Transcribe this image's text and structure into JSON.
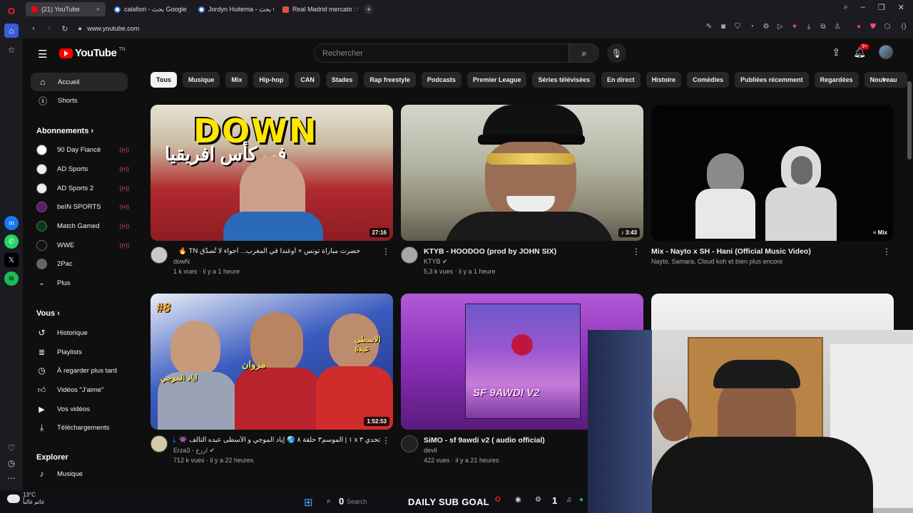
{
  "browser": {
    "tabs": [
      {
        "title": "(21) YouTube",
        "color": "#ff0000",
        "active": true
      },
      {
        "title": "calafiori - بحث Google",
        "color": "#4285f4"
      },
      {
        "title": "Jordyn Huitema - بحث Go",
        "color": "#4285f4"
      },
      {
        "title": "Real Madrid mercato : Un",
        "color": "#e0533d"
      }
    ],
    "url": "www.youtube.com"
  },
  "header": {
    "logo_text": "YouTube",
    "logo_region": "TN",
    "search_placeholder": "Rechercher",
    "notif_count": "9+"
  },
  "sidebar": {
    "main": [
      {
        "label": "Accueil",
        "icon": "home-icon"
      },
      {
        "label": "Shorts",
        "icon": "shorts-icon"
      }
    ],
    "subs_title": "Abonnements",
    "subs": [
      {
        "label": "90 Day Fiancé"
      },
      {
        "label": "AD Sports"
      },
      {
        "label": "AD Sports 2"
      },
      {
        "label": "beIN SPORTS"
      },
      {
        "label": "Match Gamed"
      },
      {
        "label": "WWE"
      },
      {
        "label": "2Pac"
      }
    ],
    "more": "Plus",
    "you_title": "Vous",
    "you": [
      {
        "label": "Historique"
      },
      {
        "label": "Playlists"
      },
      {
        "label": "À regarder plus tard"
      },
      {
        "label": "Vidéos \"J'aime\""
      },
      {
        "label": "Vos vidéos"
      },
      {
        "label": "Téléchargements"
      }
    ],
    "explore_title": "Explorer",
    "explore": [
      {
        "label": "Musique"
      }
    ]
  },
  "chips": [
    "Tous",
    "Musique",
    "Mix",
    "Hip-hop",
    "CAN",
    "Stades",
    "Rap freestyle",
    "Podcasts",
    "Premier League",
    "Séries télévisées",
    "En direct",
    "Histoire",
    "Comédies",
    "Publiées récemment",
    "Regardées",
    "Nouveau"
  ],
  "videos": [
    {
      "title": "حضرت مباراة تونس × أوغندا في المغرب... أجواء لا تُصدَّق TN 🔥",
      "channel": "dowN",
      "meta": "1 k vues · il y a 1 heure",
      "duration": "27:16"
    },
    {
      "title": "KTYB - HOODOO (prod by JOHN SIX)",
      "channel": "KTYB",
      "meta": "5,3 k vues · il y a 1 heure",
      "duration": "3:43"
    },
    {
      "title": "Mix - Nayto x SH - Hani (Official Music Video)",
      "channel": "Nayto, Samara, Cloud koh et bien plus encore",
      "meta": "",
      "duration": "Mix"
    },
    {
      "title": "تحدي ٣ x ١ | الموسم٣ حلقة ٨ 🌏 إياد الموجي و الأسطى عبده التالف 👾 👗",
      "channel": "Erza3 - ارزع",
      "meta": "712 k vues · il y a 22 heures",
      "duration": "1:52:53"
    },
    {
      "title": "SiMO - sf 9awdi v2 ( audio official)",
      "channel": "devil",
      "meta": "422 vues · il y a 21 heures",
      "duration": ""
    }
  ],
  "thumb_text": {
    "v1_headline": "DOWN",
    "v1_arabic": "في كأس افريقيا",
    "v4_number": "#8",
    "v4_names": [
      "اياد الموجي",
      "مروان",
      "الاسطى عبدة"
    ],
    "v5_cover": "SF 9AWDI V2"
  },
  "stream": {
    "weather_temp": "13°C",
    "weather_text": "غائم غالباً",
    "search_hint": "Search",
    "subgoal_label": "DAILY SUB GOAL",
    "counter_left": "0",
    "counter_right": "1"
  },
  "colors": {
    "bg": "#0f0f0f",
    "accent": "#ff0000",
    "chip": "#272727"
  }
}
